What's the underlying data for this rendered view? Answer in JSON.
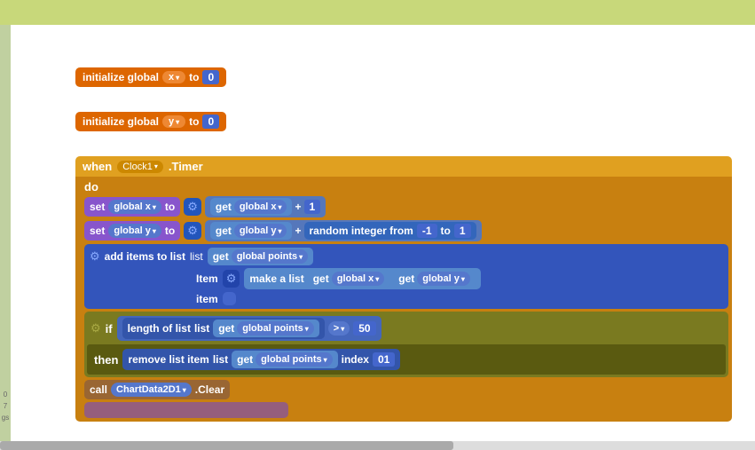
{
  "topbar": {
    "color": "#c8d87a"
  },
  "blocks": {
    "init_x": {
      "label": "initialize global",
      "var": "x",
      "to": "to",
      "value": "0"
    },
    "init_y": {
      "label": "initialize global",
      "var": "y",
      "to": "to",
      "value": "0"
    },
    "when_header": {
      "when": "when",
      "clock": "Clock1",
      "timer": ".Timer"
    },
    "do_label": "do",
    "set_x": {
      "set": "set",
      "var": "global x",
      "to": "to",
      "get": "get",
      "get_var": "global x",
      "plus": "+",
      "value": "1"
    },
    "set_y": {
      "set": "set",
      "var": "global y",
      "to": "to",
      "get": "get",
      "get_var": "global y",
      "plus": "+",
      "random": "random integer from",
      "from_val": "-1",
      "to_label": "to",
      "to_val": "1"
    },
    "add_items": {
      "label": "add items to list",
      "list_label": "list",
      "get": "get",
      "list_var": "global points",
      "item_label": "Item",
      "make_list": "make a list",
      "get_x": "get",
      "get_x_var": "global x",
      "get_y": "get",
      "get_y_var": "global y",
      "item2_label": "item"
    },
    "if_block": {
      "if_label": "if",
      "length_label": "length of list",
      "list_label": "list",
      "get": "get",
      "list_var": "global points",
      "gt": ">",
      "value": "50"
    },
    "then_block": {
      "then_label": "then",
      "remove_label": "remove list item",
      "list_label": "list",
      "get": "get",
      "list_var": "global points",
      "index_label": "index",
      "index_val": "01"
    },
    "call_block": {
      "call": "call",
      "component": "ChartData2D1",
      "method": ".Clear"
    }
  },
  "gutter_labels": [
    "0",
    "7",
    "gs"
  ]
}
